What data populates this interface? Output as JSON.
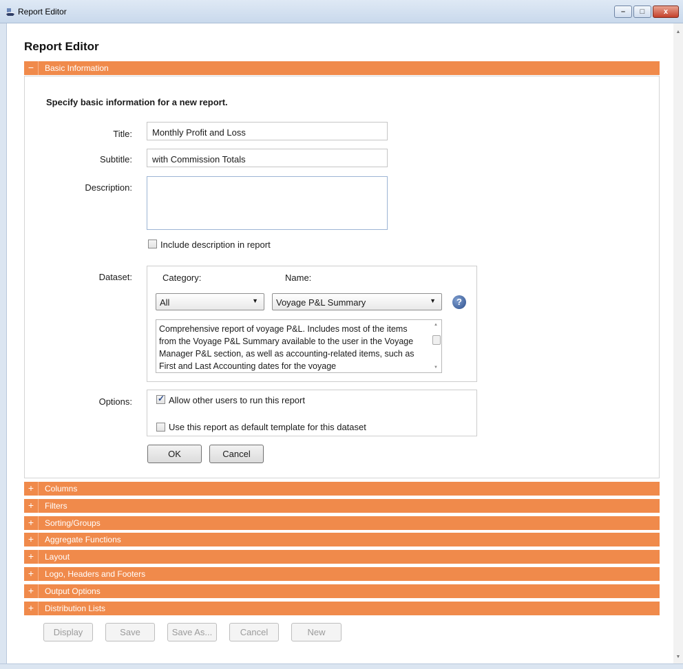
{
  "window": {
    "title": "Report Editor",
    "minimize_glyph": "–",
    "maximize_glyph": "□",
    "close_glyph": "x"
  },
  "page": {
    "heading": "Report Editor"
  },
  "sections": {
    "basic": {
      "toggle": "−",
      "label": "Basic Information"
    },
    "collapsed": [
      {
        "toggle": "+",
        "label": "Columns"
      },
      {
        "toggle": "+",
        "label": "Filters"
      },
      {
        "toggle": "+",
        "label": "Sorting/Groups"
      },
      {
        "toggle": "+",
        "label": "Aggregate Functions"
      },
      {
        "toggle": "+",
        "label": "Layout"
      },
      {
        "toggle": "+",
        "label": "Logo, Headers and Footers"
      },
      {
        "toggle": "+",
        "label": "Output Options"
      },
      {
        "toggle": "+",
        "label": "Distribution Lists"
      }
    ]
  },
  "basic_info": {
    "intro": "Specify basic information for a new report.",
    "title_label": "Title:",
    "title_value": "Monthly Profit and Loss",
    "subtitle_label": "Subtitle:",
    "subtitle_value": "with Commission Totals",
    "description_label": "Description:",
    "description_value": "",
    "include_description_label": "Include description in report",
    "include_description_checked": false,
    "dataset_label": "Dataset:",
    "category_label": "Category:",
    "category_value": "All",
    "name_label": "Name:",
    "name_value": "Voyage P&L Summary",
    "help_glyph": "?",
    "dataset_description": "Comprehensive report of voyage P&L. Includes most of the items from the Voyage P&L Summary available to the user in the Voyage Manager P&L section, as well as accounting-related items, such as First and Last Accounting dates for the voyage",
    "options_label": "Options:",
    "allow_others_label": "Allow other users to run this report",
    "allow_others_checked": true,
    "default_template_label": "Use this report as default template for this dataset",
    "default_template_checked": false,
    "ok_label": "OK",
    "cancel_label": "Cancel"
  },
  "footer_buttons": {
    "display": "Display",
    "save": "Save",
    "save_as": "Save As...",
    "cancel": "Cancel",
    "new": "New"
  },
  "colors": {
    "accent": "#f08a4b",
    "titlebar": "#c9d9ec"
  }
}
